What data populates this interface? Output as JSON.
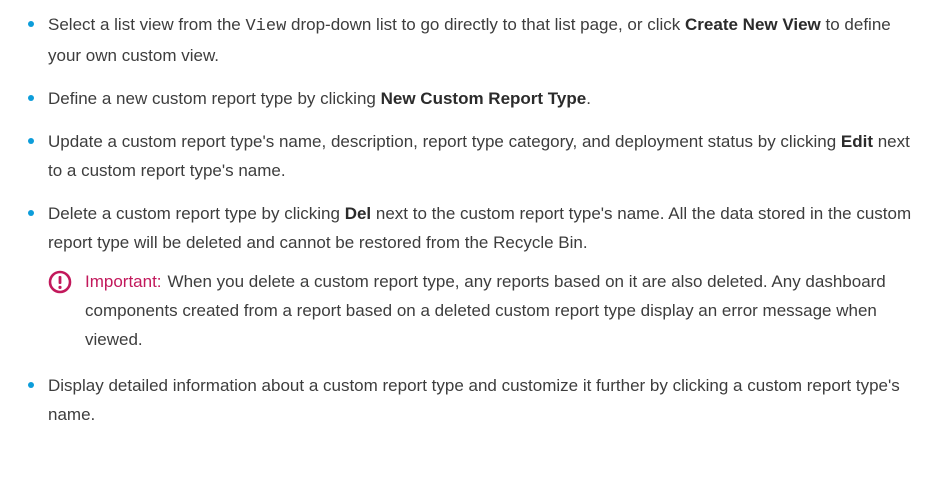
{
  "colors": {
    "bullet": "#0d9dda",
    "important": "#c2185b",
    "text": "#3d3d3d"
  },
  "items": [
    {
      "pre": "Select a list view from the ",
      "code": "View",
      "mid": " drop-down list to go directly to that list page, or click ",
      "bold": "Create New View",
      "post": " to define your own custom view."
    },
    {
      "pre": "Define a new custom report type by clicking ",
      "bold": "New Custom Report Type",
      "post": "."
    },
    {
      "pre": "Update a custom report type's name, description, report type category, and deployment status by clicking ",
      "bold": "Edit",
      "post": " next to a custom report type's name."
    },
    {
      "pre": "Delete a custom report type by clicking ",
      "bold": "Del",
      "post": " next to the custom report type's name. All the data stored in the custom report type will be deleted and cannot be restored from the Recycle Bin."
    },
    {
      "text": "Display detailed information about a custom report type and customize it further by clicking a custom report type's name."
    }
  ],
  "note": {
    "icon": "important-icon",
    "label": "Important:",
    "text": "When you delete a custom report type, any reports based on it are also deleted. Any dashboard components created from a report based on a deleted custom report type display an error message when viewed."
  }
}
